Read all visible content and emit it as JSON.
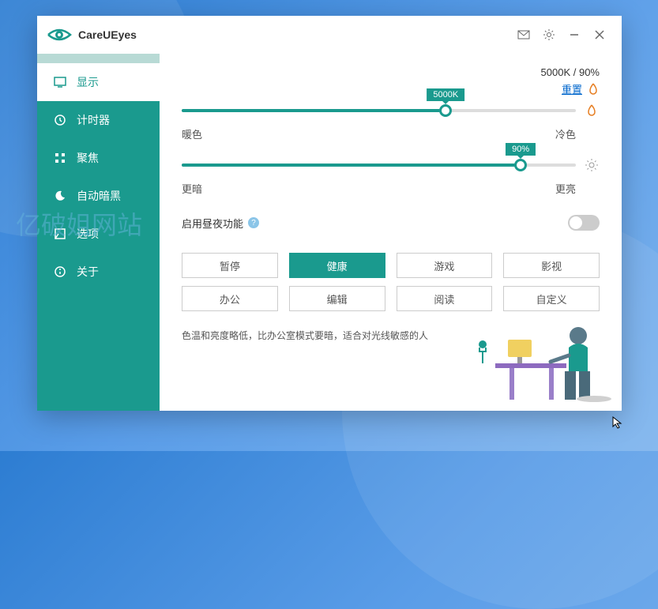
{
  "app": {
    "name": "CareUEyes"
  },
  "watermark": "亿破姐网站",
  "sidebar": {
    "items": [
      {
        "label": "显示",
        "icon": "monitor"
      },
      {
        "label": "计时器",
        "icon": "clock"
      },
      {
        "label": "聚焦",
        "icon": "grid"
      },
      {
        "label": "自动暗黑",
        "icon": "moon"
      },
      {
        "label": "选项",
        "icon": "settings-square"
      },
      {
        "label": "关于",
        "icon": "info"
      }
    ],
    "active_index": 0
  },
  "status": {
    "text": "5000K / 90%",
    "reset": "重置"
  },
  "sliders": {
    "temperature": {
      "value_label": "5000K",
      "percent": 67,
      "left_label": "暖色",
      "right_label": "冷色"
    },
    "brightness": {
      "value_label": "90%",
      "percent": 86,
      "left_label": "更暗",
      "right_label": "更亮"
    }
  },
  "daynight": {
    "label": "启用昼夜功能",
    "enabled": false
  },
  "modes": {
    "items": [
      "暂停",
      "健康",
      "游戏",
      "影视",
      "办公",
      "编辑",
      "阅读",
      "自定义"
    ],
    "active_index": 1
  },
  "description": "色温和亮度略低，比办公室模式要暗，适合对光线敏感的人"
}
